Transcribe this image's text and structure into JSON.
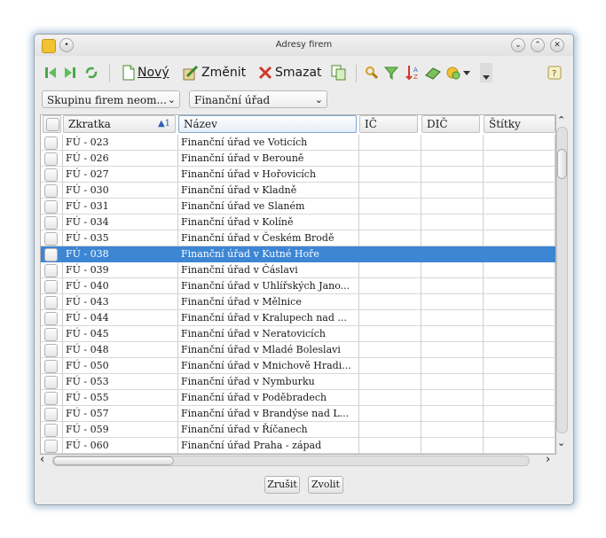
{
  "window": {
    "title": "Adresy firem"
  },
  "toolbar": {
    "new_label": "Nový",
    "edit_label": "Změnit",
    "delete_label": "Smazat"
  },
  "filters": {
    "group": "Skupinu firem neom...",
    "category": "Finanční úřad"
  },
  "table": {
    "columns": [
      "Zkratka",
      "Název",
      "IČ",
      "DIČ",
      "Štítky"
    ],
    "sort_indicator": "▲1",
    "selected_index": 7,
    "rows": [
      {
        "code": "FÚ - 023",
        "name": "Finanční úřad ve Voticích"
      },
      {
        "code": "FÚ - 026",
        "name": "Finanční úřad v Berouně"
      },
      {
        "code": "FÚ - 027",
        "name": "Finanční úřad v Hořovicích"
      },
      {
        "code": "FÚ - 030",
        "name": "Finanční úřad v Kladně"
      },
      {
        "code": "FÚ - 031",
        "name": "Finanční úřad ve Slaném"
      },
      {
        "code": "FÚ - 034",
        "name": "Finanční úřad v Kolíně"
      },
      {
        "code": "FÚ - 035",
        "name": "Finanční úřad v Českém Brodě"
      },
      {
        "code": "FÚ - 038",
        "name": "Finanční úřad v Kutné Hoře"
      },
      {
        "code": "FÚ - 039",
        "name": "Finanční úřad v Čáslavi"
      },
      {
        "code": "FÚ - 040",
        "name": "Finanční úřad v Uhlířských Jano..."
      },
      {
        "code": "FÚ - 043",
        "name": "Finanční úřad v Mělnice"
      },
      {
        "code": "FÚ - 044",
        "name": "Finanční úřad v Kralupech nad ..."
      },
      {
        "code": "FÚ - 045",
        "name": "Finanční úřad v Neratovicích"
      },
      {
        "code": "FÚ - 048",
        "name": "Finanční úřad v Mladé Boleslavi"
      },
      {
        "code": "FÚ - 050",
        "name": "Finanční úřad v Mnichově Hradi..."
      },
      {
        "code": "FÚ - 053",
        "name": "Finanční úřad v Nymburku"
      },
      {
        "code": "FÚ - 055",
        "name": "Finanční úřad v Poděbradech"
      },
      {
        "code": "FÚ - 057",
        "name": "Finanční úřad v Brandýse nad L..."
      },
      {
        "code": "FÚ - 059",
        "name": "Finanční úřad v Říčanech"
      },
      {
        "code": "FÚ - 060",
        "name": "Finanční úřad Praha - západ"
      }
    ]
  },
  "footer": {
    "cancel_label": "Zrušit",
    "choose_label": "Zvolit"
  },
  "colors": {
    "selection": "#3d86d4",
    "accent_glow": "#6e96be"
  }
}
